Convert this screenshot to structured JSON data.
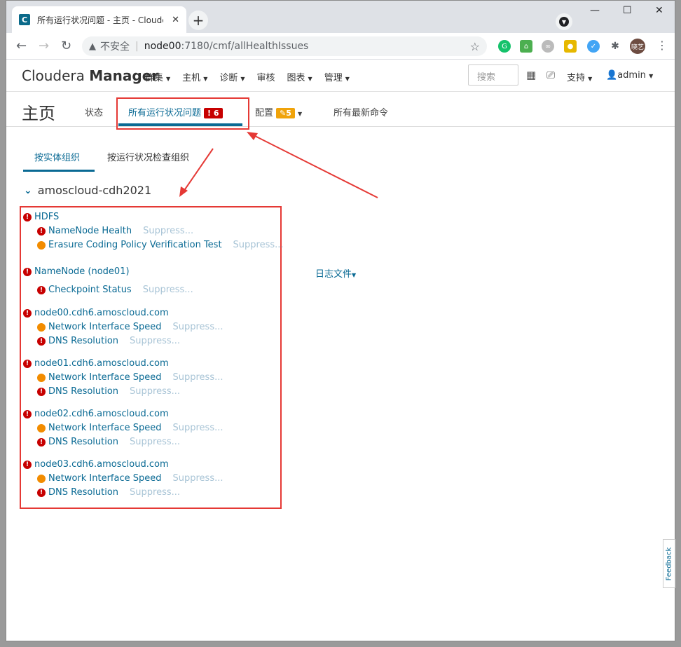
{
  "browser": {
    "tab_title": "所有运行状况问题 - 主页 - Cloudera",
    "favicon_letter": "C",
    "address_warning": "不安全",
    "url_host": "node00",
    "url_path": ":7180/cmf/allHealthIssues",
    "profile_text": "晓艺"
  },
  "header": {
    "logo_light": "Cloudera ",
    "logo_bold": "Manager",
    "menu": [
      "群集",
      "主机",
      "诊断",
      "审核",
      "图表",
      "管理"
    ],
    "search_placeholder": "搜索",
    "support": "支持",
    "user": "admin"
  },
  "subnav": {
    "page_title": "主页",
    "tab_status": "状态",
    "tab_issues": "所有运行状况问题",
    "issues_count": "6",
    "tab_config": "配置",
    "config_count": "5",
    "tab_commands": "所有最新命令"
  },
  "inner_tabs": [
    "按实体组织",
    "按运行状况检查组织"
  ],
  "cluster_name": "amoscloud-cdh2021",
  "suppress_label": "Suppress...",
  "log_files_label": "日志文件",
  "feedback_label": "Feedback",
  "groups": [
    {
      "name": "HDFS",
      "items": [
        {
          "label": "NameNode Health",
          "severity": "bad"
        },
        {
          "label": "Erasure Coding Policy Verification Test",
          "severity": "concerning"
        }
      ]
    },
    {
      "name": "NameNode (node01)",
      "items": [
        {
          "label": "Checkpoint Status",
          "severity": "bad"
        }
      ]
    },
    {
      "name": "node00.cdh6.amoscloud.com",
      "items": [
        {
          "label": "Network Interface Speed",
          "severity": "concerning"
        },
        {
          "label": "DNS Resolution",
          "severity": "bad"
        }
      ]
    },
    {
      "name": "node01.cdh6.amoscloud.com",
      "items": [
        {
          "label": "Network Interface Speed",
          "severity": "concerning"
        },
        {
          "label": "DNS Resolution",
          "severity": "bad"
        }
      ]
    },
    {
      "name": "node02.cdh6.amoscloud.com",
      "items": [
        {
          "label": "Network Interface Speed",
          "severity": "concerning"
        },
        {
          "label": "DNS Resolution",
          "severity": "bad"
        }
      ]
    },
    {
      "name": "node03.cdh6.amoscloud.com",
      "items": [
        {
          "label": "Network Interface Speed",
          "severity": "concerning"
        },
        {
          "label": "DNS Resolution",
          "severity": "bad"
        }
      ]
    }
  ],
  "colors": {
    "link": "#0a6a94",
    "bad": "#c70000",
    "concerning": "#f28c00",
    "annotation": "#e53935"
  }
}
